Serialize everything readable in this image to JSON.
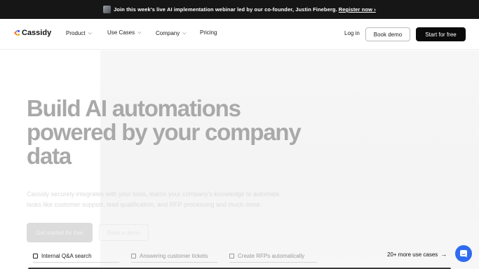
{
  "announcement": {
    "text": "Join this week's live AI implementation webinar led by our co-founder, Justin Fineberg.",
    "link": "Register now ›"
  },
  "nav": {
    "logo": "Cassidy",
    "items": [
      {
        "label": "Product",
        "has_dropdown": true
      },
      {
        "label": "Use Cases",
        "has_dropdown": true
      },
      {
        "label": "Company",
        "has_dropdown": true
      },
      {
        "label": "Pricing",
        "has_dropdown": false
      }
    ],
    "chevron": "⌵",
    "login": "Log in",
    "book_demo": "Book demo",
    "start_free": "Start for free"
  },
  "hero": {
    "headline_line1": "Build AI automations",
    "headline_line2": "powered by your company",
    "headline_line3": "data",
    "subtext_line1": "Cassidy securely integrates with your tools, learns your company's knowledge to automate",
    "subtext_line2": "tasks like customer support, lead qualification, and RFP processing and much more.",
    "cta_primary": "Get started for free",
    "cta_secondary": "Book a demo"
  },
  "use_cases": {
    "tabs": [
      {
        "label": "Internal Q&A search",
        "active": true
      },
      {
        "label": "Answering customer tickets",
        "active": false
      },
      {
        "label": "Create RFPs automatically",
        "active": false
      }
    ],
    "more": "20+ more use cases",
    "more_arrow": "→"
  },
  "colors": {
    "accent_orange": "#f26b2a",
    "accent_blue": "#3b6ef5",
    "chat_blue": "#2f6bf0",
    "dark": "#0b0b0b"
  },
  "icons": [
    "avatar-thumbnail",
    "cassidy-logo-icon",
    "chevron-down-icon",
    "document-icon",
    "arrow-right-icon",
    "chat-icon"
  ]
}
